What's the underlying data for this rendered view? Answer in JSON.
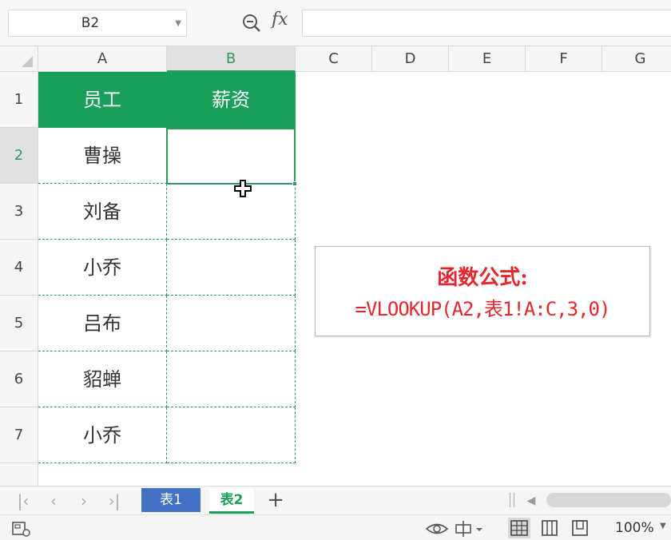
{
  "formula_bar": {
    "name_box": "B2",
    "fx_label": "fx",
    "formula": ""
  },
  "columns": [
    "A",
    "B",
    "C",
    "D",
    "E",
    "F",
    "G"
  ],
  "rows": [
    "1",
    "2",
    "3",
    "4",
    "5",
    "6",
    "7"
  ],
  "table": {
    "header": [
      "员工",
      "薪资"
    ],
    "employees": [
      "曹操",
      "刘备",
      "小乔",
      "吕布",
      "貂蝉",
      "小乔"
    ]
  },
  "note": {
    "line1": "函数公式:",
    "line2": "=VLOOKUP(A2,表1!A:C,3,0)"
  },
  "sheet_tabs": {
    "tab1": "表1",
    "tab2": "表2",
    "add": "+"
  },
  "status": {
    "zoom": "100%"
  },
  "colors": {
    "accent": "#18a05a",
    "note_text": "#e6262d",
    "tab1_bg": "#4472c4"
  }
}
